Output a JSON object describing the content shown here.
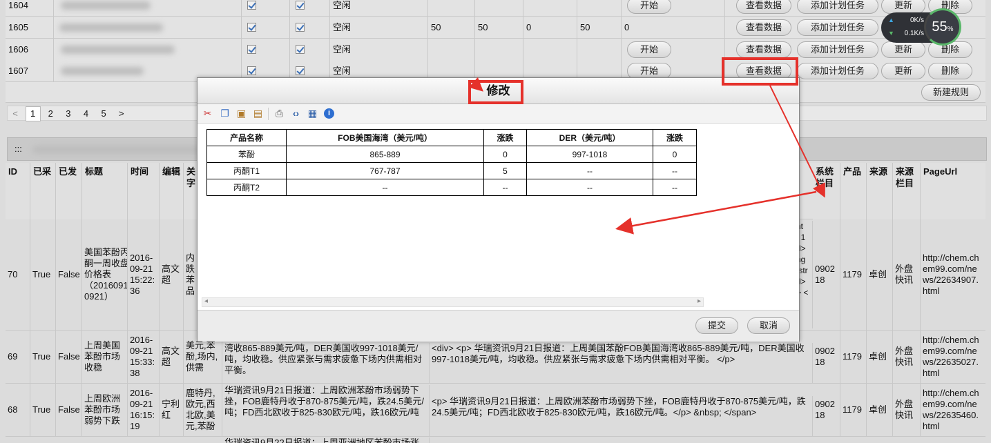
{
  "task_rows": [
    {
      "id": "1604",
      "status": "空闲",
      "v1": "",
      "v2": "",
      "v3": "",
      "v4": "",
      "v5": "",
      "action": "开始"
    },
    {
      "id": "1605",
      "status": "空闲",
      "v1": "50",
      "v2": "50",
      "v3": "0",
      "v4": "50",
      "v5": "0",
      "action": ""
    },
    {
      "id": "1606",
      "status": "空闲",
      "v1": "",
      "v2": "",
      "v3": "",
      "v4": "",
      "v5": "",
      "action": "开始"
    },
    {
      "id": "1607",
      "status": "空闲",
      "v1": "",
      "v2": "",
      "v3": "",
      "v4": "",
      "v5": "",
      "action": "开始"
    }
  ],
  "row_buttons": {
    "view": "查看数据",
    "add_task": "添加计划任务",
    "update": "更新",
    "delete": "删除"
  },
  "new_rule": "新建规则",
  "pager": {
    "prev": "<",
    "pages": [
      "1",
      "2",
      "3",
      "4",
      "5"
    ],
    "next": ">"
  },
  "section_prefix": ":::",
  "columns": {
    "id": "ID",
    "collected": "已采",
    "published": "已发",
    "title": "标题",
    "time": "时间",
    "editor": "编辑",
    "trunc": "关字",
    "sys_column": "系统栏目",
    "product": "产品",
    "source": "来源",
    "source_column": "来源栏目",
    "page_url": "PageUrl"
  },
  "records": [
    {
      "id": "70",
      "collected": "True",
      "published": "False",
      "title": "美国苯酚丙酮一周收盘价格表（20160914-0921）",
      "time": "2016-09-21 15:22:36",
      "editor": "高文超",
      "trunc": "内跌苯品",
      "html_frag": "nt\n: 1\nd>\nng\n/str\nd>\n> <",
      "sys": "090218",
      "product": "1179",
      "source": "卓创",
      "src_col": "外盘快讯",
      "url": "http://chem.chem99.com/news/22634907.html"
    },
    {
      "id": "69",
      "collected": "True",
      "published": "False",
      "title": "上周美国苯酚市场收稳",
      "time": "2016-09-21 15:33:38",
      "editor": "高文超",
      "trunc": "美元,苯酚,场内,供需",
      "content": "湾收865-889美元/吨，DER美国收997-1018美元/吨，均收稳。供应紧张与需求疲惫下场内供需相对平衡。",
      "raw": "<div> <p>      华瑞资讯9月21日报道：上周美国苯酚FOB美国海湾收865-889美元/吨，DER美国收997-1018美元/吨，均收稳。供应紧张与需求疲惫下场内供需相对平衡。 </p>",
      "sys": "090218",
      "product": "1179",
      "source": "卓创",
      "src_col": "外盘快讯",
      "url": "http://chem.chem99.com/news/22635027.html"
    },
    {
      "id": "68",
      "collected": "True",
      "published": "False",
      "title": "上周欧洲苯酚市场弱势下跌",
      "time": "2016-09-21 16:15:19",
      "editor": "宁利红",
      "trunc": "鹿特丹,欧元,西北欧,美元,苯酚",
      "content": "华瑞资讯9月21日报道：上周欧洲苯酚市场弱势下挫，FOB鹿特丹收于870-875美元/吨，跌24.5美元/吨；FD西北欧收于825-830欧元/吨，跌16欧元/吨",
      "raw": "<p>      华瑞资讯9月21日报道：上周欧洲苯酚市场弱势下挫，FOB鹿特丹收于870-875美元/吨，跌24.5美元/吨；FD西北欧收于825-830欧元/吨，跌16欧元/吨。</p> &nbsp; </span>",
      "sys": "090218",
      "product": "1179",
      "source": "卓创",
      "src_col": "外盘快讯",
      "url": "http://chem.chem99.com/news/22635460.html"
    }
  ],
  "bottom_partial": "华瑞资讯9月22日报道：上周亚洲地区苯酚市场涨跌",
  "dialog": {
    "title": "修改",
    "table_header": [
      "产品名称",
      "FOB美国海湾（美元/吨）",
      "涨跌",
      "DER（美元/吨）",
      "涨跌"
    ],
    "table_rows": [
      [
        "苯酚",
        "865-889",
        "0",
        "997-1018",
        "0"
      ],
      [
        "丙酮T1",
        "767-787",
        "5",
        "--",
        "--"
      ],
      [
        "丙酮T2",
        "--",
        "--",
        "--",
        "--"
      ]
    ],
    "submit": "提交",
    "cancel": "取消"
  },
  "net_widget": {
    "up": "0K/s",
    "down": "0.1K/s",
    "percent": "55",
    "percent_unit": "%"
  },
  "colors": {
    "highlight": "#e5312b",
    "accent_up": "#3da6e0",
    "accent_down": "#5ab86a"
  }
}
